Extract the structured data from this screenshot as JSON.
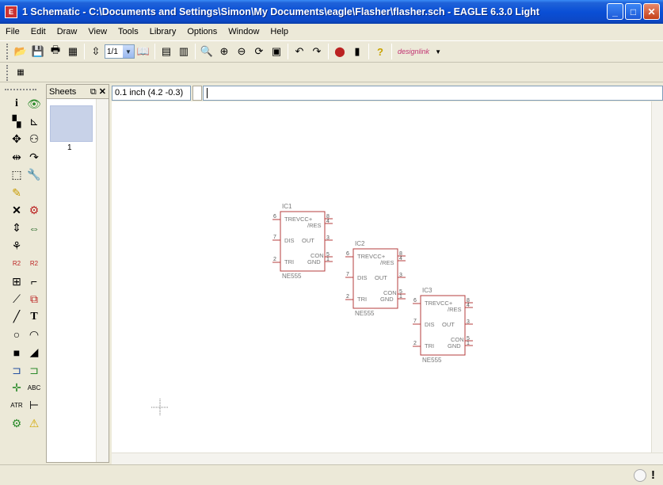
{
  "window": {
    "title": "1 Schematic - C:\\Documents and Settings\\Simon\\My Documents\\eagle\\Flasher\\flasher.sch - EAGLE 6.3.0 Light"
  },
  "menu": [
    "File",
    "Edit",
    "Draw",
    "View",
    "Tools",
    "Library",
    "Options",
    "Window",
    "Help"
  ],
  "toolbar": {
    "zoom_value": "1/1",
    "designlink_label": "designlink"
  },
  "sheets_panel": {
    "title": "Sheets",
    "sheet_number": "1"
  },
  "coordinate_display": "0.1 inch (4.2 -0.3)",
  "command_line_value": "",
  "schematic": {
    "parts": [
      {
        "name": "IC1",
        "value": "NE555"
      },
      {
        "name": "IC2",
        "value": "NE555"
      },
      {
        "name": "IC3",
        "value": "NE555"
      }
    ],
    "pin_labels": {
      "trevcc": "TREVCC+",
      "res": "/RES",
      "dis": "DIS",
      "out": "OUT",
      "con": "CON",
      "tri": "TRI",
      "gnd": "GND"
    },
    "pin_numbers": {
      "left_top": "6",
      "left_mid": "7",
      "left_bot": "2",
      "right_a": "8",
      "right_b": "4",
      "right_c": "3",
      "right_d": "5",
      "right_e": "1"
    }
  },
  "colors": {
    "component": "#b43c3c",
    "text_gray": "#777777",
    "titlebar": "#0a4fd6"
  }
}
